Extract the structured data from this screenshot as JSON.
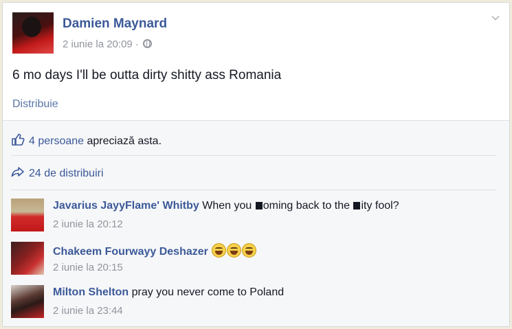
{
  "post": {
    "author": "Damien Maynard",
    "date": "2 iunie la 20:09 ·",
    "privacy_icon": "globe-icon",
    "text": "6 mo days I'll be outta dirty shitty ass Romania",
    "share_link": "Distribuie"
  },
  "feedback": {
    "likes_link": "4 persoane",
    "likes_suffix": " apreciază asta.",
    "shares": "24 de distribuiri"
  },
  "comments": [
    {
      "author": "Javarius JayyFlame' Whitby",
      "text_part1": " When you ",
      "text_part2": "oming back to the ",
      "text_part3": "ity fool?",
      "time": "2 iunie la 20:12"
    },
    {
      "author": "Chakeem Fourwayy Deshazer",
      "emoji_count": 3,
      "time": "2 iunie la 20:15"
    },
    {
      "author": "Milton Shelton",
      "text": " pray you never come to Poland",
      "time": "2 iunie la 23:44"
    }
  ],
  "colors": {
    "link": "#3b5998",
    "meta": "#90949c",
    "feedback_bg": "#f6f7f9"
  }
}
